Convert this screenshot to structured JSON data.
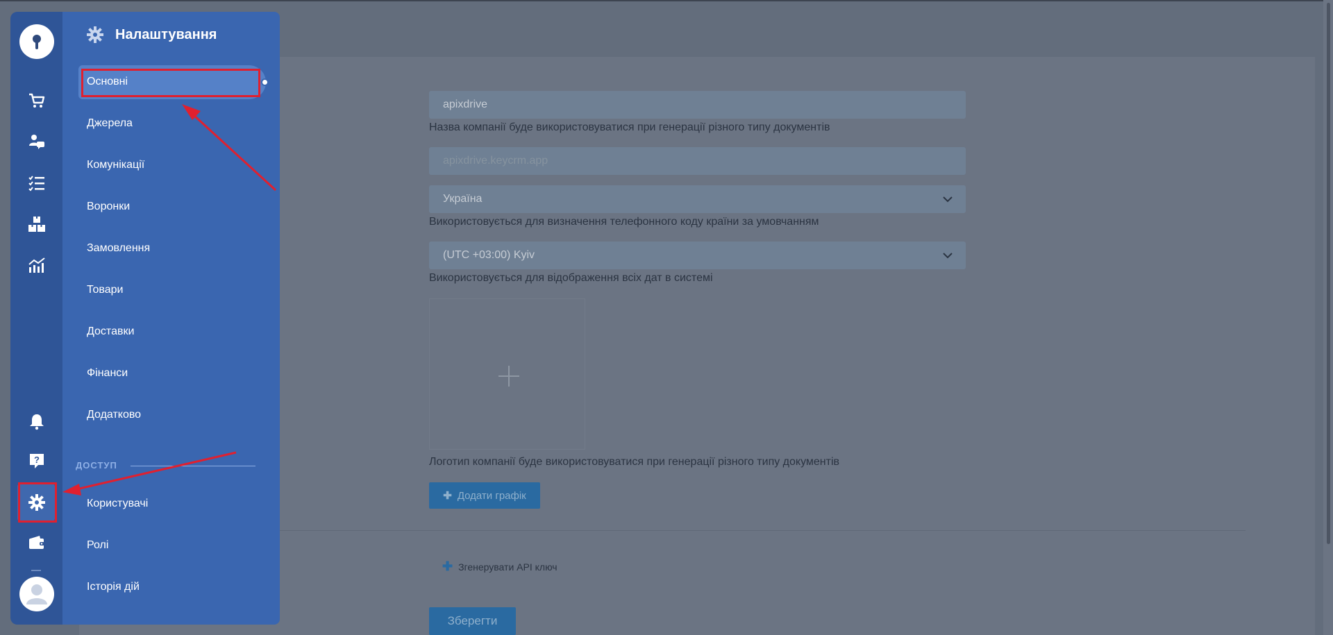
{
  "panel": {
    "title": "Налаштування",
    "items": [
      {
        "label": "Основні"
      },
      {
        "label": "Джерела"
      },
      {
        "label": "Комунікації"
      },
      {
        "label": "Воронки"
      },
      {
        "label": "Замовлення"
      },
      {
        "label": "Товари"
      },
      {
        "label": "Доставки"
      },
      {
        "label": "Фінанси"
      },
      {
        "label": "Додатково"
      }
    ],
    "section_access": "ДОСТУП",
    "access_items": [
      {
        "label": "Користувачі"
      },
      {
        "label": "Ролі"
      },
      {
        "label": "Історія дій"
      }
    ]
  },
  "rail": {
    "icons": [
      "cart-icon",
      "clients-chat-icon",
      "tasks-list-icon",
      "warehouse-boxes-icon",
      "analytics-chart-icon",
      "bell-icon",
      "help-icon",
      "gear-icon",
      "wallet-icon"
    ]
  },
  "form": {
    "company_name_value": "apixdrive",
    "company_name_hint": "Назва компанії буде використовуватися при генерації різного типу документів",
    "domain_placeholder": "apixdrive.keycrm.app",
    "country_value": "Україна",
    "country_hint": "Використовується для визначення телефонного коду країни за умовчанням",
    "timezone_value": "(UTC +03:00) Kyiv",
    "timezone_hint": "Використовується для відображення всіх дат в системі",
    "logo_hint": "Логотип компанії буде використовуватися при генерації різного типу документів",
    "add_chart_label": "Додати графік",
    "generate_api_label": "Згенерувати API ключ",
    "save_label": "Зберегти"
  },
  "colors": {
    "panel": "#3a66b0",
    "rail": "#2f5597",
    "highlight": "#e0202f"
  }
}
